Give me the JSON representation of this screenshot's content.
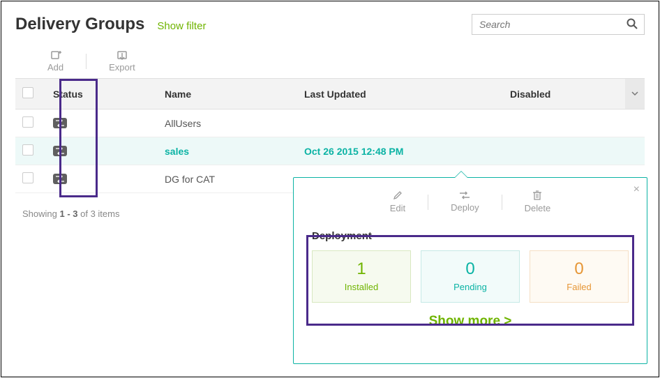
{
  "header": {
    "title": "Delivery Groups",
    "show_filter": "Show filter",
    "search_placeholder": "Search"
  },
  "toolbar": {
    "add": "Add",
    "export": "Export"
  },
  "columns": {
    "status": "Status",
    "name": "Name",
    "last_updated": "Last Updated",
    "disabled": "Disabled"
  },
  "rows": [
    {
      "name": "AllUsers",
      "last_updated": "",
      "disabled": ""
    },
    {
      "name": "sales",
      "last_updated": "Oct 26 2015 12:48 PM",
      "disabled": ""
    },
    {
      "name": "DG for CAT",
      "last_updated": "",
      "disabled": ""
    }
  ],
  "pager_html": "Showing <b>1 - 3</b> of 3 items",
  "popover": {
    "edit": "Edit",
    "deploy": "Deploy",
    "delete": "Delete",
    "section_title": "Deployment",
    "cards": {
      "installed": {
        "value": "1",
        "label": "Installed"
      },
      "pending": {
        "value": "0",
        "label": "Pending"
      },
      "failed": {
        "value": "0",
        "label": "Failed"
      }
    },
    "show_more": "Show more >"
  }
}
